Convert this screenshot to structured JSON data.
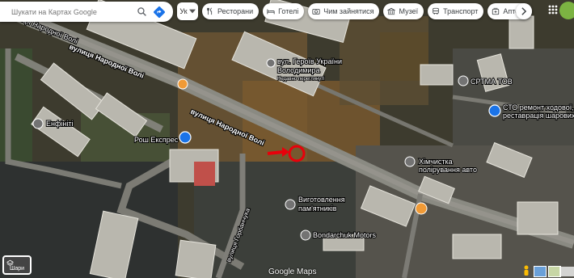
{
  "search": {
    "placeholder": "Шукати на Картах Google"
  },
  "lang_chip": "Ук",
  "chips": [
    {
      "label": "Ресторани",
      "icon": "restaurant-icon"
    },
    {
      "label": "Готелі",
      "icon": "hotel-icon"
    },
    {
      "label": "Чим зайнятися",
      "icon": "camera-icon"
    },
    {
      "label": "Музеї",
      "icon": "museum-icon"
    },
    {
      "label": "Транспорт",
      "icon": "transit-icon"
    },
    {
      "label": "Аптеки",
      "icon": "pharmacy-icon"
    }
  ],
  "streets": {
    "volia_short": "вулиця Народної Волі",
    "volia_top": "вулиця Народної Волі",
    "volia_mid": "вулиця Народної Волі",
    "horbanchuka": "вулиця Горбанчука"
  },
  "places": {
    "gerov_line1": "вул. Героїв України",
    "gerov_line2": "Володимира",
    "gerov_sub": "Недавно переглянуті",
    "enfiniti": "Енфініті",
    "rosh": "Рош Експрес",
    "kharkiv": "СРТМА ТОВ",
    "sto_line1": "СТО ремонт ходової,",
    "sto_line2": "реставрація шарових...",
    "khimchystka_line1": "Хімчистка",
    "khimchystka_line2": "полірування авто",
    "vyhotovlennia_line1": "Виготовлення",
    "vyhotovlennia_line2": "пам'ятників",
    "bondarchuk": "Bondarchuk Motors"
  },
  "layers_label": "Шари",
  "logo_text": "Google Maps",
  "colors": {
    "marker_red": "#e8000b",
    "poi_blue": "#1a73e8",
    "poi_orange": "#f09a36",
    "poi_grey": "#737373"
  }
}
